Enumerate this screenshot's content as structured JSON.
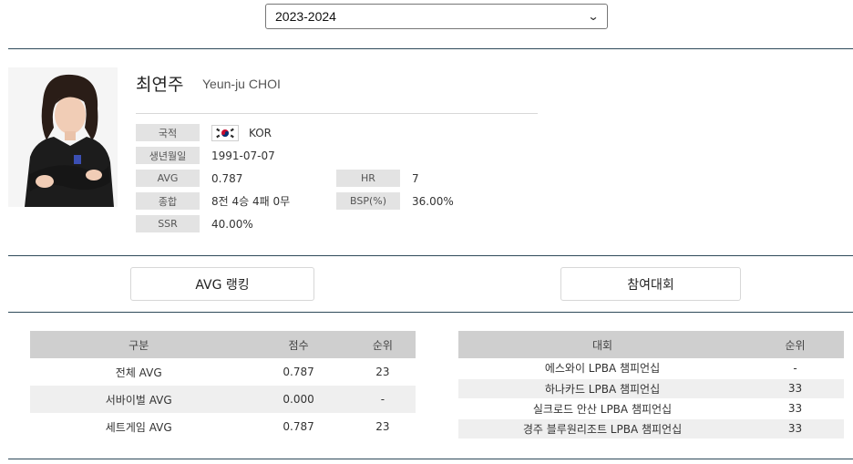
{
  "season_select": {
    "selected": "2023-2024"
  },
  "player": {
    "name_kr": "최연주",
    "name_en": "Yeun-ju CHOI",
    "info": {
      "nationality_label": "국적",
      "nationality_value": "KOR",
      "birth_label": "생년월일",
      "birth_value": "1991-07-07",
      "avg_label": "AVG",
      "avg_value": "0.787",
      "hr_label": "HR",
      "hr_value": "7",
      "total_label": "종합",
      "total_value": "8전 4승 4패 0무",
      "bsp_label": "BSP(%)",
      "bsp_value": "36.00%",
      "ssr_label": "SSR",
      "ssr_value": "40.00%"
    }
  },
  "buttons": {
    "avg_ranking": "AVG 랭킹",
    "tournaments": "참여대회"
  },
  "avg_table": {
    "headers": [
      "구분",
      "점수",
      "순위"
    ],
    "rows": [
      [
        "전체 AVG",
        "0.787",
        "23"
      ],
      [
        "서바이벌 AVG",
        "0.000",
        "-"
      ],
      [
        "세트게임 AVG",
        "0.787",
        "23"
      ]
    ]
  },
  "tournament_table": {
    "headers": [
      "대회",
      "순위"
    ],
    "rows": [
      [
        "에스와이 LPBA 챔피언십",
        "-"
      ],
      [
        "하나카드 LPBA 챔피언십",
        "33"
      ],
      [
        "실크로드 안산 LPBA 챔피언십",
        "33"
      ],
      [
        "경주 블루원리조트 LPBA 챔피언십",
        "33"
      ]
    ]
  },
  "colors": {
    "rule": "#2e4a5a",
    "label_bg": "#e3e3e3",
    "table_header_bg": "#cfcfcf",
    "row_alt_bg": "#efefef"
  }
}
